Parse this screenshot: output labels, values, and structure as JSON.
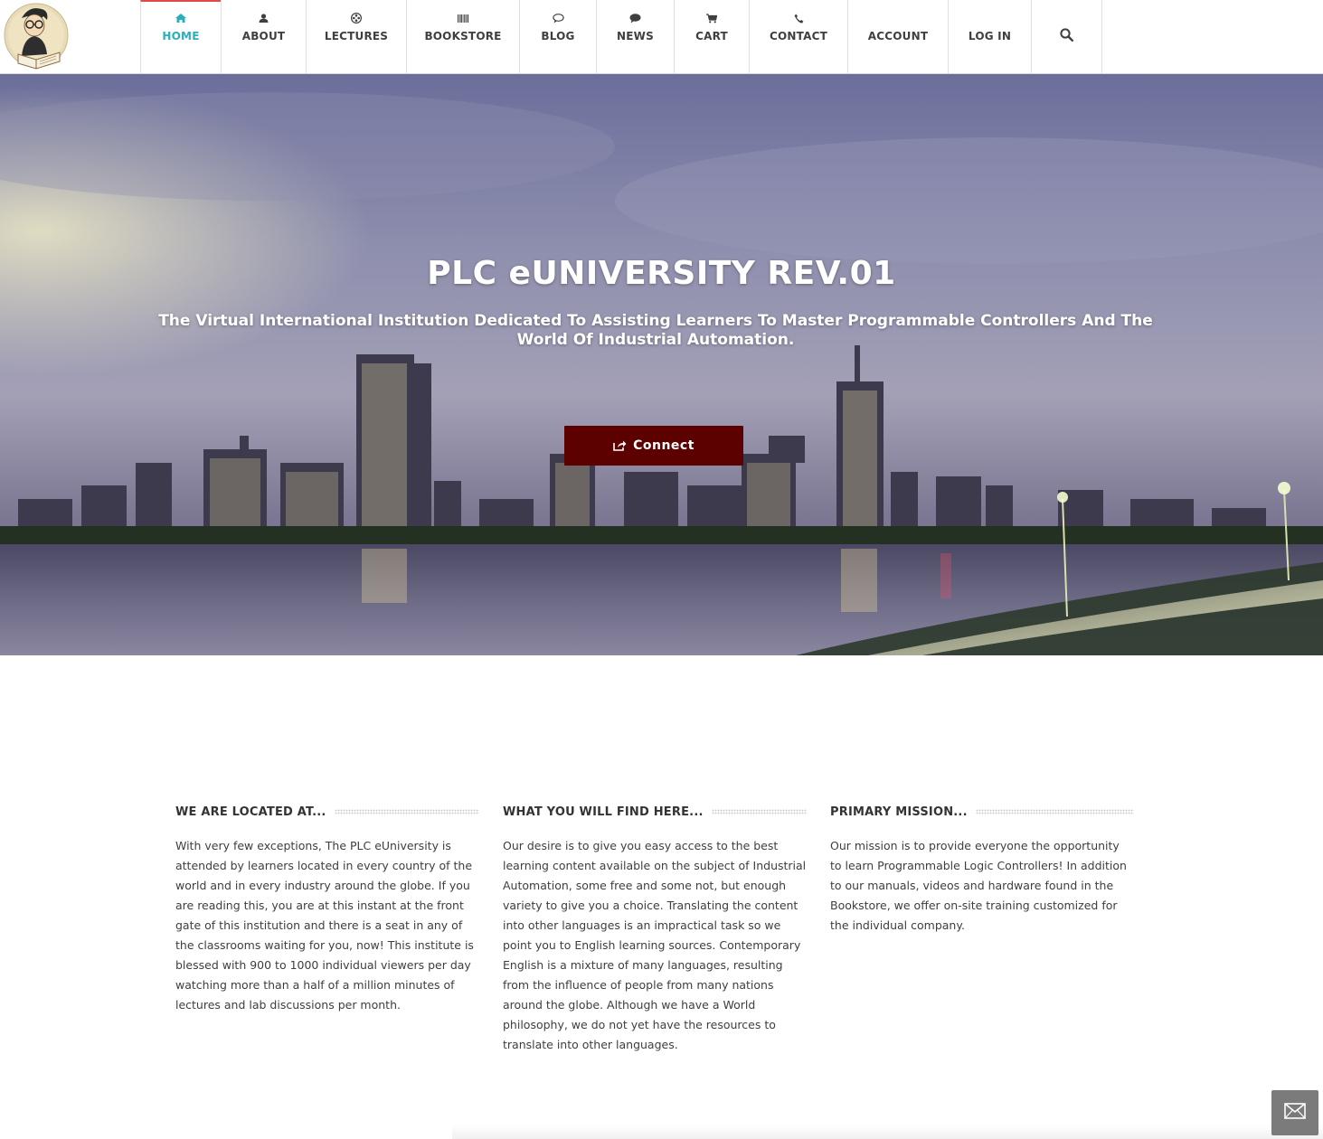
{
  "nav": {
    "items": [
      {
        "label": "HOME",
        "icon": "home-icon",
        "active": true
      },
      {
        "label": "ABOUT",
        "icon": "user-icon"
      },
      {
        "label": "LECTURES",
        "icon": "film-reel-icon"
      },
      {
        "label": "BOOKSTORE",
        "icon": "barcode-icon"
      },
      {
        "label": "BLOG",
        "icon": "comment-outline-icon"
      },
      {
        "label": "NEWS",
        "icon": "comment-icon"
      },
      {
        "label": "CART",
        "icon": "cart-icon"
      },
      {
        "label": "CONTACT",
        "icon": "phone-icon"
      },
      {
        "label": "ACCOUNT"
      },
      {
        "label": "LOG IN"
      }
    ],
    "search_icon": "search-icon",
    "active_color": "#2ab0bd",
    "active_border_color": "#e24b4b"
  },
  "hero": {
    "title": "PLC eUNIVERSITY REV.01",
    "subtitle": "The Virtual International Institution Dedicated To Assisting Learners To Master Programmable Controllers And The World Of Industrial Automation.",
    "button_label": "Connect",
    "button_icon": "share-icon",
    "button_color": "#5c0000"
  },
  "columns": [
    {
      "title": "WE ARE LOCATED AT...",
      "text": "With very few exceptions, The PLC eUniversity is attended by learners located in every country of the world and in every industry around the globe. If you are reading this, you are at this instant at the front gate of this institution and there is a seat in any of the classrooms waiting for you, now! This institute is blessed with 900 to 1000 individual viewers per day watching more than a half of a million minutes of lectures and lab discussions per month."
    },
    {
      "title": "WHAT YOU WILL FIND HERE...",
      "text": "Our desire is to give you easy access to the best learning content available on the subject of Industrial Automation, some free and some not, but enough variety to give you a choice. Translating the content into other languages is an impractical task so we point you to English learning sources. Contemporary English is a mixture of many languages, resulting from the influence of people from many nations around the globe. Although we have a World philosophy, we do not yet have the resources to translate into other languages."
    },
    {
      "title": "PRIMARY MISSION...",
      "text": "Our mission is to provide everyone the opportunity to learn Programmable Logic Controllers! In addition to our manuals, videos and hardware found in the Bookstore, we offer on-site training customized for the individual company."
    }
  ],
  "floating": {
    "mail_icon": "mail-icon"
  }
}
